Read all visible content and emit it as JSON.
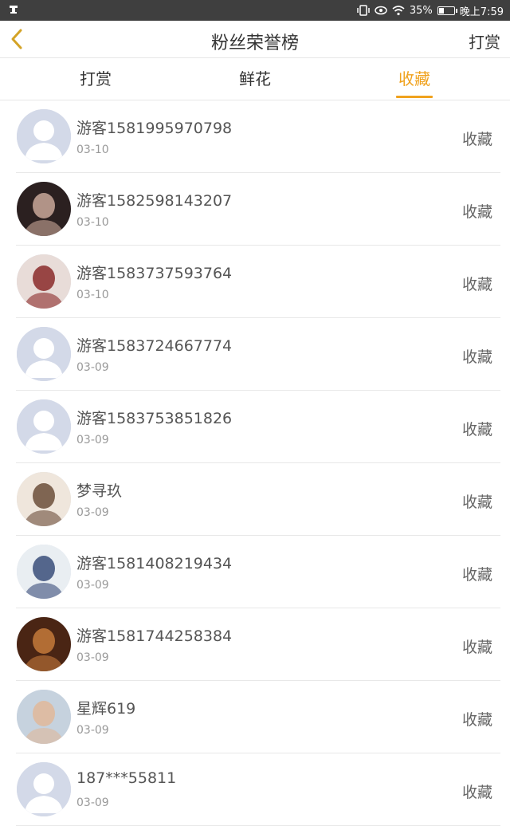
{
  "status_bar": {
    "battery": "35%",
    "battery_level": 0.35,
    "time": "晚上7:59"
  },
  "header": {
    "title": "粉丝荣誉榜",
    "right_label": "打赏",
    "accent_color": "#f0a21e"
  },
  "tabs": [
    {
      "label": "打赏",
      "active": false
    },
    {
      "label": "鲜花",
      "active": false
    },
    {
      "label": "收藏",
      "active": true
    }
  ],
  "list": [
    {
      "name": "游客1581995970798",
      "date": "03-10",
      "action": "收藏",
      "avatar": "default-avatar"
    },
    {
      "name": "游客1582598143207",
      "date": "03-10",
      "action": "收藏",
      "avatar": "photo-avatar"
    },
    {
      "name": "游客1583737593764",
      "date": "03-10",
      "action": "收藏",
      "avatar": "photo-avatar"
    },
    {
      "name": "游客1583724667774",
      "date": "03-09",
      "action": "收藏",
      "avatar": "default-avatar"
    },
    {
      "name": "游客1583753851826",
      "date": "03-09",
      "action": "收藏",
      "avatar": "default-avatar"
    },
    {
      "name": "梦寻玖",
      "date": "03-09",
      "action": "收藏",
      "avatar": "photo-avatar"
    },
    {
      "name": "游客1581408219434",
      "date": "03-09",
      "action": "收藏",
      "avatar": "photo-avatar"
    },
    {
      "name": "游客1581744258384",
      "date": "03-09",
      "action": "收藏",
      "avatar": "photo-avatar"
    },
    {
      "name": "星辉619",
      "date": "03-09",
      "action": "收藏",
      "avatar": "photo-avatar"
    },
    {
      "name": "187***55811",
      "date": "03-09",
      "action": "收藏",
      "avatar": "default-avatar"
    }
  ]
}
